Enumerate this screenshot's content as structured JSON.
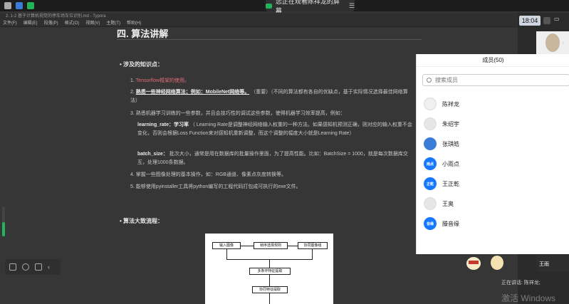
{
  "share_banner": {
    "text": "您正在观看陈祥龙的屏幕"
  },
  "clock": "18:04",
  "typora": {
    "title": "2. 1-2 基于计算机视觉的停车场车位识别.md - Typora",
    "menu": [
      "文件(F)",
      "编辑(E)",
      "段落(P)",
      "格式(O)",
      "视图(V)",
      "主题(T)",
      "帮助(H)"
    ]
  },
  "doc": {
    "heading": "四. 算法讲解",
    "section1": "涉及的知识点：",
    "items": [
      "Tensorflow框架的使用。",
      "熟悉一些神经网络算法；例如：MobileNet网络等。",
      "熟悉机器学习训练的一些参数，并且会技巧性的调试这些参数，使得机器学习效率提高，例如：",
      "掌握一些图像处理的基本操作，如：RGB通道、像素点灰度转换等。",
      "能够使用pyinstaller工具将python编写的工程代码打包成可执行的exe文件。"
    ],
    "item2_suffix": "（重要）（不同的算法都有各自的优缺点，基于实际情况选择最佳网络算法）",
    "lr_label": "learning_rate：学习率",
    "lr_text": "（ Learning Rate是调整神经网络输入权重的一种方法。如果感知机预测正确，则对应的输入权重不会变化，否则会根据Loss Function来对感知机重新调整，而这个调整的幅度大小就是Learning Rate）",
    "bs_label": "batch_size：",
    "bs_text": "批次大小，通常是用在数据库的批量操作里面，为了提高性能。比如：BatchSize = 1000，就是每次数据库交互，处理1000条数据。",
    "section2": "算法大致流程：",
    "flow": [
      "输入图像",
      "帧序选择规则",
      "协同图像组",
      "多条环特征提取",
      "协同特征提取"
    ]
  },
  "members": {
    "title": "成员(50)",
    "search_placeholder": "搜索成员",
    "list": [
      {
        "name": "陈祥龙",
        "avatar": "",
        "color": "#f2f2f2"
      },
      {
        "name": "朱绍宇",
        "avatar": "",
        "color": "#e8e8e8"
      },
      {
        "name": "张琪皓",
        "avatar": "",
        "color": "#3a7bd5"
      },
      {
        "name": "小雨点",
        "avatar": "雨点",
        "color": "#1677ff"
      },
      {
        "name": "王正乾",
        "avatar": "正乾",
        "color": "#1677ff"
      },
      {
        "name": "王奥",
        "avatar": "",
        "color": "#e6e6e6"
      },
      {
        "name": "滕音缘",
        "avatar": "音缘",
        "color": "#1677ff"
      }
    ]
  },
  "video2_name": "王雨",
  "speaker": "正在讲话: 陈祥龙;",
  "watermark": "激活 Windows"
}
